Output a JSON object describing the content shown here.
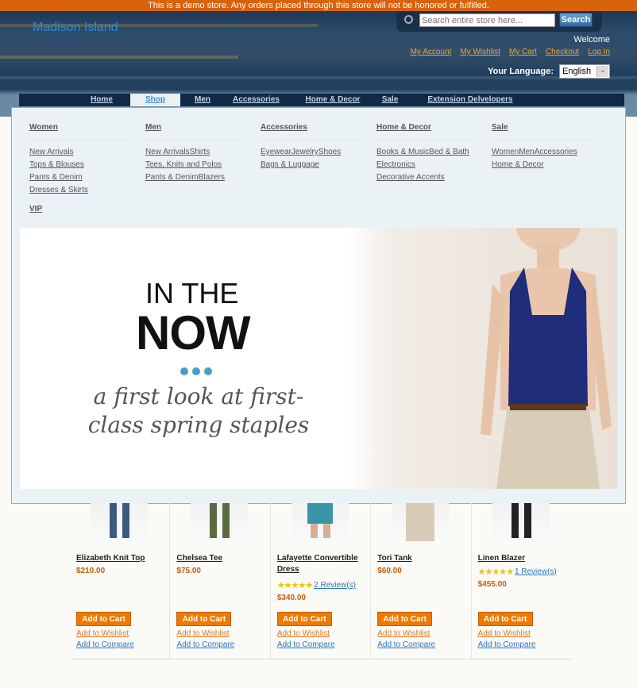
{
  "notice": "This is a demo store. Any orders placed through this store will not be honored or fulfilled.",
  "header": {
    "logo": "Madison Island",
    "search_placeholder": "Search entire store here...",
    "search_button": "Search",
    "welcome": "Welcome",
    "links": [
      "My Account",
      "My Wishlist",
      "My Cart",
      "Checkout",
      "Log In"
    ],
    "language_label": "Your Language:",
    "language_value": "English"
  },
  "nav": [
    "Home",
    "Shop",
    "Men",
    "Accessories",
    "Home & Decor",
    "Sale",
    "Extension Delvelopers"
  ],
  "mega": {
    "columns": [
      {
        "title": "Women",
        "items": [
          "New Arrivals",
          "Tops & Blouses",
          "Pants & Denim",
          "Dresses & Skirts"
        ]
      },
      {
        "title": "Men",
        "items": [
          "New ArrivalsShirts",
          "Tees, Knits and Polos",
          "Pants & DenimBlazers"
        ]
      },
      {
        "title": "Accessories",
        "items": [
          "EyewearJewelryShoes",
          "Bags & Luggage"
        ]
      },
      {
        "title": "Home & Decor",
        "items": [
          "Books & MusicBed & Bath",
          "Electronics",
          "Decorative Accents"
        ]
      },
      {
        "title": "Sale",
        "items": [
          "WomenMenAccessories",
          "Home & Decor"
        ]
      }
    ],
    "vip": "VIP"
  },
  "banner": {
    "line1": "IN THE",
    "line2": "NOW",
    "line3": "a first look at first-class spring staples"
  },
  "products": [
    {
      "name": "Elizabeth Knit Top",
      "price": "$210.00",
      "rating": null,
      "reviews": null
    },
    {
      "name": "Chelsea Tee",
      "price": "$75.00",
      "rating": null,
      "reviews": null
    },
    {
      "name": "Lafayette Convertible Dress",
      "price": "$340.00",
      "rating": 5,
      "reviews": "2 Review(s)"
    },
    {
      "name": "Tori Tank",
      "price": "$60.00",
      "rating": null,
      "reviews": null
    },
    {
      "name": "Linen Blazer",
      "price": "$455.00",
      "rating": 5,
      "reviews": "1 Review(s)"
    }
  ],
  "product_actions": {
    "cart": "Add to Cart",
    "wishlist": "Add to Wishlist",
    "compare": "Add to Compare"
  },
  "colors": {
    "accent": "#ef7a00",
    "link": "#2a78c0",
    "header": "#1d3552"
  }
}
